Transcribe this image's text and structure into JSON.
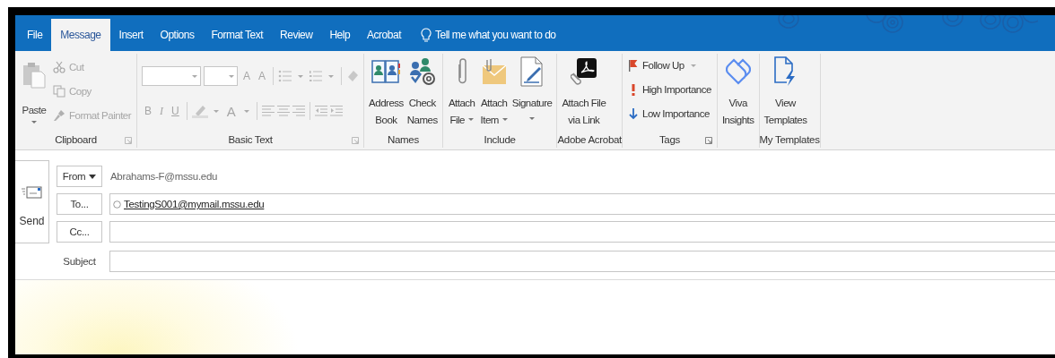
{
  "tabs": [
    {
      "label": "File",
      "selected": false
    },
    {
      "label": "Message",
      "selected": true
    },
    {
      "label": "Insert",
      "selected": false
    },
    {
      "label": "Options",
      "selected": false
    },
    {
      "label": "Format Text",
      "selected": false
    },
    {
      "label": "Review",
      "selected": false
    },
    {
      "label": "Help",
      "selected": false
    },
    {
      "label": "Acrobat",
      "selected": false
    }
  ],
  "tell_me": "Tell me what you want to do",
  "ribbon": {
    "groups": [
      {
        "kind": "clipboard",
        "label": "Clipboard",
        "launcher": true,
        "items": [
          {
            "label": "Paste",
            "disabled": true
          },
          {
            "label": "Cut",
            "disabled": true
          },
          {
            "label": "Copy",
            "disabled": true
          },
          {
            "label": "Format Painter",
            "disabled": true
          }
        ]
      },
      {
        "kind": "basic-text",
        "label": "Basic Text",
        "launcher": true,
        "items": [
          {
            "label": "A",
            "disabled": true
          },
          {
            "label": "A",
            "disabled": true
          },
          {
            "label": "B",
            "disabled": true
          },
          {
            "label": "I",
            "disabled": true
          },
          {
            "label": "U",
            "disabled": true
          },
          {
            "label": "A",
            "disabled": true
          }
        ]
      },
      {
        "kind": "large",
        "label": "Names",
        "launcher": false,
        "items": [
          {
            "lines": [
              "Address",
              "Book"
            ],
            "dropdown": false
          },
          {
            "lines": [
              "Check",
              "Names"
            ],
            "dropdown": false
          }
        ]
      },
      {
        "kind": "large",
        "label": "Include",
        "launcher": false,
        "items": [
          {
            "lines": [
              "Attach",
              "File"
            ],
            "dropdown": true
          },
          {
            "lines": [
              "Attach",
              "Item"
            ],
            "dropdown": true
          },
          {
            "lines": [
              "Signature"
            ],
            "dropdown": true
          }
        ]
      },
      {
        "kind": "large",
        "label": "Adobe Acrobat",
        "launcher": false,
        "items": [
          {
            "lines": [
              "Attach File",
              "via Link"
            ],
            "dropdown": false
          }
        ]
      },
      {
        "kind": "small",
        "label": "Tags",
        "launcher": true,
        "items": [
          {
            "label": "Follow Up",
            "dropdown": true
          },
          {
            "label": "High Importance",
            "dropdown": false
          },
          {
            "label": "Low Importance",
            "dropdown": false
          }
        ]
      },
      {
        "kind": "large",
        "launcher": false,
        "items": [
          {
            "lines": [
              "Viva",
              "Insights"
            ],
            "dropdown": false
          }
        ]
      },
      {
        "kind": "large",
        "label": "My Templates",
        "launcher": false,
        "items": [
          {
            "lines": [
              "View",
              "Templates"
            ],
            "dropdown": false
          }
        ]
      }
    ]
  },
  "compose": {
    "send": "Send",
    "from": {
      "button": "From",
      "value": "Abrahams-F@mssu.edu"
    },
    "to": {
      "button": "To...",
      "recipients": [
        "TestingS001@mymail.mssu.edu"
      ]
    },
    "cc": {
      "button": "Cc..."
    },
    "subject": {
      "label": "Subject"
    }
  }
}
